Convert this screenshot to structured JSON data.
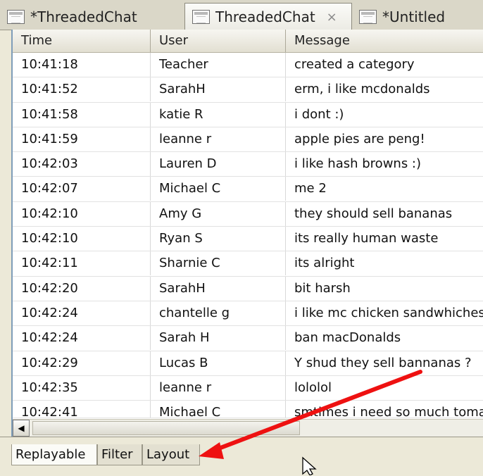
{
  "editor_tabs": [
    {
      "label": "*ThreadedChat",
      "icon": "document-icon"
    },
    {
      "label": "ThreadedChat",
      "icon": "document-icon",
      "close": "×"
    },
    {
      "label": "*Untitled",
      "icon": "document-icon"
    }
  ],
  "table": {
    "columns": [
      "Time",
      "User",
      "Message"
    ],
    "rows": [
      [
        "10:41:18",
        "Teacher",
        "created a category"
      ],
      [
        "10:41:52",
        "SarahH",
        "erm, i like mcdonalds"
      ],
      [
        "10:41:58",
        "katie R",
        "i dont :)"
      ],
      [
        "10:41:59",
        "leanne r",
        "apple pies are peng!"
      ],
      [
        "10:42:03",
        "Lauren D",
        "i like hash browns :)"
      ],
      [
        "10:42:07",
        "Michael C",
        "me 2"
      ],
      [
        "10:42:10",
        "Amy G",
        "they should sell bananas"
      ],
      [
        "10:42:10",
        "Ryan S",
        "its really human waste"
      ],
      [
        "10:42:11",
        "Sharnie C",
        "its alright"
      ],
      [
        "10:42:20",
        "SarahH",
        "bit harsh"
      ],
      [
        "10:42:24",
        "chantelle g",
        "i like mc chicken sandwhiches"
      ],
      [
        "10:42:24",
        "Sarah H",
        "ban macDonalds"
      ],
      [
        "10:42:29",
        "Lucas B",
        "Y shud they sell bannanas ?"
      ],
      [
        "10:42:35",
        "leanne r",
        "lololol"
      ],
      [
        "10:42:41",
        "Michael C",
        "smtimes i need so much tomato"
      ]
    ]
  },
  "scrollbar": {
    "left_arrow": "◀"
  },
  "bottom_tabs": [
    "Replayable",
    "Filter",
    "Layout"
  ],
  "annotation": {
    "arrow_color": "#ee1111"
  }
}
